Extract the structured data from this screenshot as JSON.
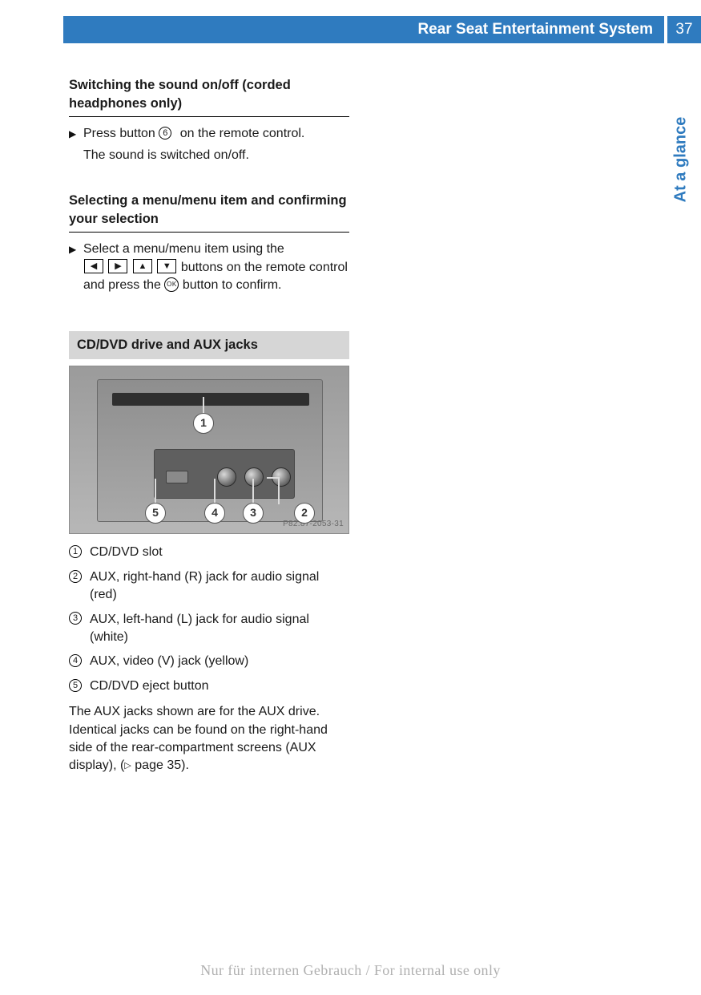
{
  "header": {
    "title": "Rear Seat Entertainment System",
    "page_number": "37"
  },
  "side_tab": "At a glance",
  "section1": {
    "heading": "Switching the sound on/off (corded headphones only)",
    "step_line1_a": "Press button ",
    "step_line1_num": "6",
    "step_line1_b": " on the remote control.",
    "step_line2": "The sound is switched on/off."
  },
  "section2": {
    "heading": "Selecting a menu/menu item and confirming your selection",
    "step_a": "Select a menu/menu item using the",
    "btn_left": "◀",
    "btn_right": "▶",
    "btn_up": "▲",
    "btn_down": "▼",
    "step_b": " buttons on the remote control and press the ",
    "ok_label": "OK",
    "step_c": " button to confirm."
  },
  "grey_heading": "CD/DVD drive and AUX jacks",
  "figure": {
    "code": "P82.87-2053-31",
    "callouts": {
      "c1": "1",
      "c2": "2",
      "c3": "3",
      "c4": "4",
      "c5": "5"
    }
  },
  "legend": {
    "n1": "1",
    "t1": "CD/DVD slot",
    "n2": "2",
    "t2": "AUX, right-hand (R) jack for audio signal (red)",
    "n3": "3",
    "t3": "AUX, left-hand (L) jack for audio signal (white)",
    "n4": "4",
    "t4": "AUX, video (V) jack (yellow)",
    "n5": "5",
    "t5": "CD/DVD eject button"
  },
  "paragraph": {
    "a": "The AUX jacks shown are for the AUX drive. Identical jacks can be found on the right-hand side of the rear-compartment screens (AUX display), (",
    "tri": "▷",
    "b": " page 35)."
  },
  "footer": "Nur für internen Gebrauch / For internal use only"
}
